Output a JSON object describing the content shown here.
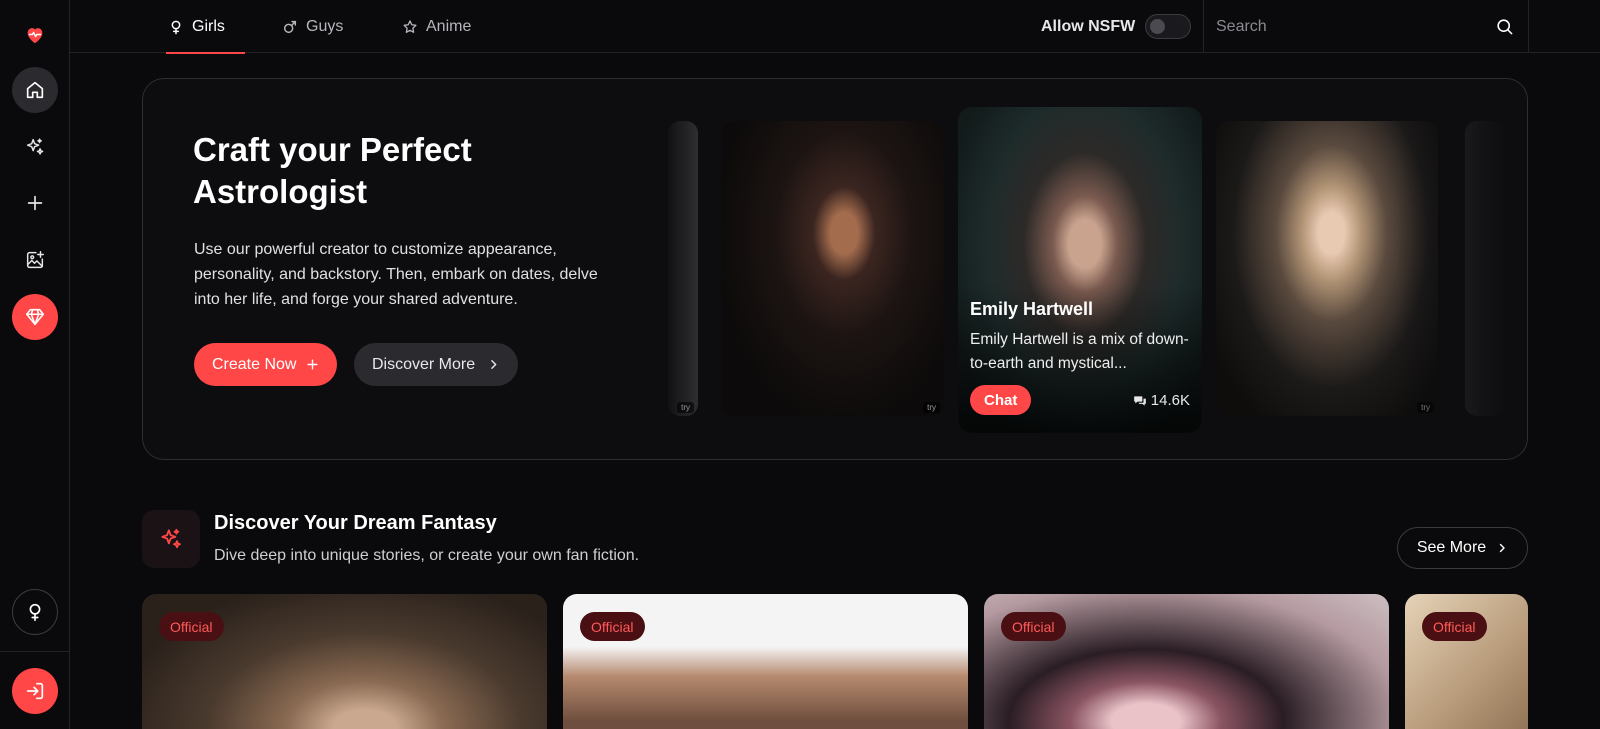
{
  "nav": {
    "tabs": [
      {
        "label": "Girls",
        "icon": "female-icon",
        "active": true
      },
      {
        "label": "Guys",
        "icon": "male-icon",
        "active": false
      },
      {
        "label": "Anime",
        "icon": "star-icon",
        "active": false
      }
    ],
    "nsfw_label": "Allow NSFW",
    "nsfw_enabled": false,
    "search_placeholder": "Search"
  },
  "sidebar": {
    "items": [
      "heart-pulse-logo-icon",
      "home-icon",
      "sparkles-icon",
      "plus-icon",
      "image-add-icon",
      "gem-icon",
      "female-icon",
      "logout-icon"
    ]
  },
  "hero": {
    "title": "Craft your Perfect Astrologist",
    "description": "Use our powerful creator to customize appearance, personality, and backstory. Then, embark on dates, delve into her life, and forge your shared adventure.",
    "create_label": "Create Now",
    "discover_label": "Discover More",
    "carousel": {
      "featured": {
        "name": "Emily Hartwell",
        "description": "Emily Hartwell is a mix of down-to-earth and mystical...",
        "chat_label": "Chat",
        "count": "14.6K"
      },
      "watermark": "try"
    }
  },
  "section": {
    "title": "Discover Your Dream Fantasy",
    "subtitle": "Dive deep into unique stories, or create your own fan fiction.",
    "see_more_label": "See More",
    "cards": [
      {
        "badge": "Official"
      },
      {
        "badge": "Official"
      },
      {
        "badge": "Official"
      },
      {
        "badge": "Official"
      }
    ]
  },
  "colors": {
    "accent": "#ff4747",
    "background": "#0a0a0c",
    "badge_bg": "#4a0f12"
  }
}
